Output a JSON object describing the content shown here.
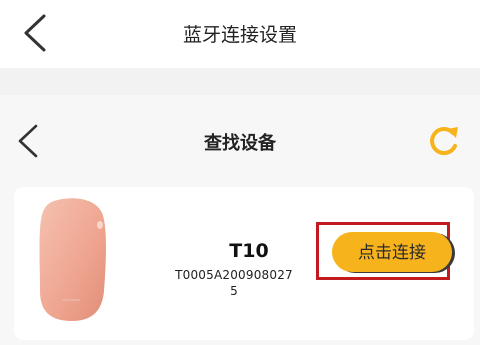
{
  "header": {
    "title": "蓝牙连接设置",
    "back_icon": "chevron-left-icon"
  },
  "panel": {
    "title": "查找设备",
    "back_icon": "chevron-left-icon",
    "refresh_icon": "refresh-icon",
    "accent_color": "#f7b31c"
  },
  "device": {
    "name": "T10",
    "serial": "T0005A2009080275",
    "connect_label": "点击连接",
    "highlight_color": "#c21a1f"
  }
}
